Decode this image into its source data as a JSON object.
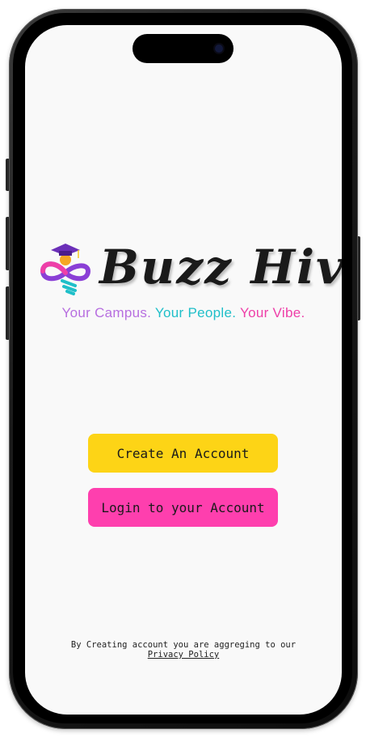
{
  "brand": {
    "name": "Buzz Hive",
    "logo_icon": "graduation-bee-icon",
    "tagline": {
      "part1": "Your Campus.",
      "part2": "Your People.",
      "part3": "Your Vibe."
    }
  },
  "actions": {
    "create_account_label": "Create An Account",
    "login_label": "Login to your Account"
  },
  "footer": {
    "text": "By Creating account you are aggreging to our",
    "link": "Privacy Policy"
  },
  "colors": {
    "create_button": "#fdd416",
    "login_button": "#fe3fae",
    "tagline_purple": "#b76fe0",
    "tagline_teal": "#1fbfc9",
    "tagline_pink": "#ee3fa8",
    "screen_background": "#f9f9f9"
  }
}
